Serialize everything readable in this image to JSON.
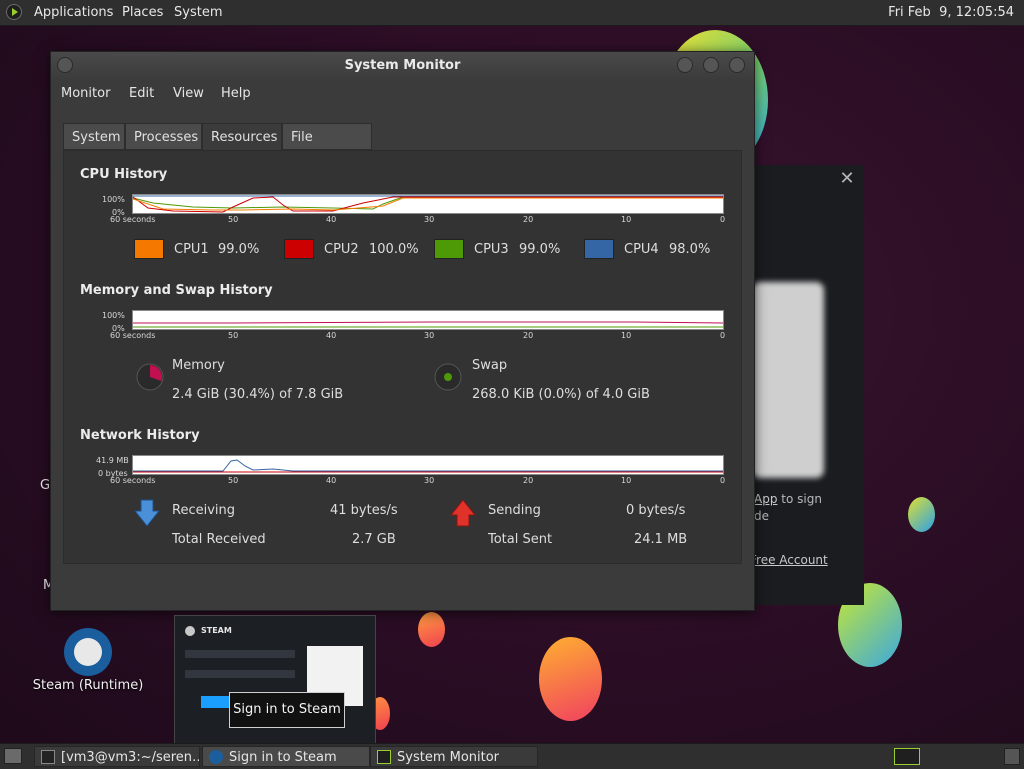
{
  "top_panel": {
    "menus": [
      "Applications",
      "Places",
      "System"
    ],
    "clock": "Fri Feb  9, 12:05:54"
  },
  "window": {
    "title": "System Monitor",
    "menu": [
      "Monitor",
      "Edit",
      "View",
      "Help"
    ],
    "tabs": [
      "System",
      "Processes",
      "Resources",
      "File Systems"
    ],
    "active_tab": "Resources"
  },
  "resources": {
    "cpu": {
      "title": "CPU History",
      "y_top": "100%",
      "y_bottom": "0%",
      "x_labels": [
        "60 seconds",
        "50",
        "40",
        "30",
        "20",
        "10",
        "0"
      ],
      "cores": [
        {
          "name": "CPU1",
          "value": "99.0%",
          "color": "#f57900"
        },
        {
          "name": "CPU2",
          "value": "100.0%",
          "color": "#cc0000"
        },
        {
          "name": "CPU3",
          "value": "99.0%",
          "color": "#4e9a06"
        },
        {
          "name": "CPU4",
          "value": "98.0%",
          "color": "#3465a4"
        }
      ]
    },
    "memory": {
      "title": "Memory and Swap History",
      "y_top": "100%",
      "y_bottom": "0%",
      "x_labels": [
        "60 seconds",
        "50",
        "40",
        "30",
        "20",
        "10",
        "0"
      ],
      "memory_label": "Memory",
      "memory_value": "2.4 GiB (30.4%) of 7.8 GiB",
      "memory_fraction": 0.304,
      "memory_color": "#c01050",
      "swap_label": "Swap",
      "swap_value": "268.0 KiB (0.0%) of 4.0 GiB",
      "swap_fraction": 0.0,
      "swap_color": "#4e9a06"
    },
    "network": {
      "title": "Network History",
      "y_top": "41.9 MB",
      "y_bottom": "0 bytes",
      "x_labels": [
        "60 seconds",
        "50",
        "40",
        "30",
        "20",
        "10",
        "0"
      ],
      "receiving_label": "Receiving",
      "receiving_value": "41 bytes/s",
      "total_received_label": "Total Received",
      "total_received_value": "2.7 GB",
      "sending_label": "Sending",
      "sending_value": "0 bytes/s",
      "total_sent_label": "Total Sent",
      "total_sent_value": "24.1 MB"
    }
  },
  "desktop": {
    "steam_runtime_label": "Steam (Runtime)",
    "partial_letter_1": "G",
    "partial_letter_2": "M"
  },
  "steam_dialog": {
    "app_link": "App",
    "app_line_rest": " to sign",
    "line2": "de",
    "free_account": "Free Account"
  },
  "thumbnail": {
    "brand": "STEAM",
    "tooltip": "Sign in to Steam"
  },
  "taskbar": {
    "tasks": [
      "[vm3@vm3:~/seren…",
      "Sign in to Steam",
      "System Monitor"
    ]
  }
}
